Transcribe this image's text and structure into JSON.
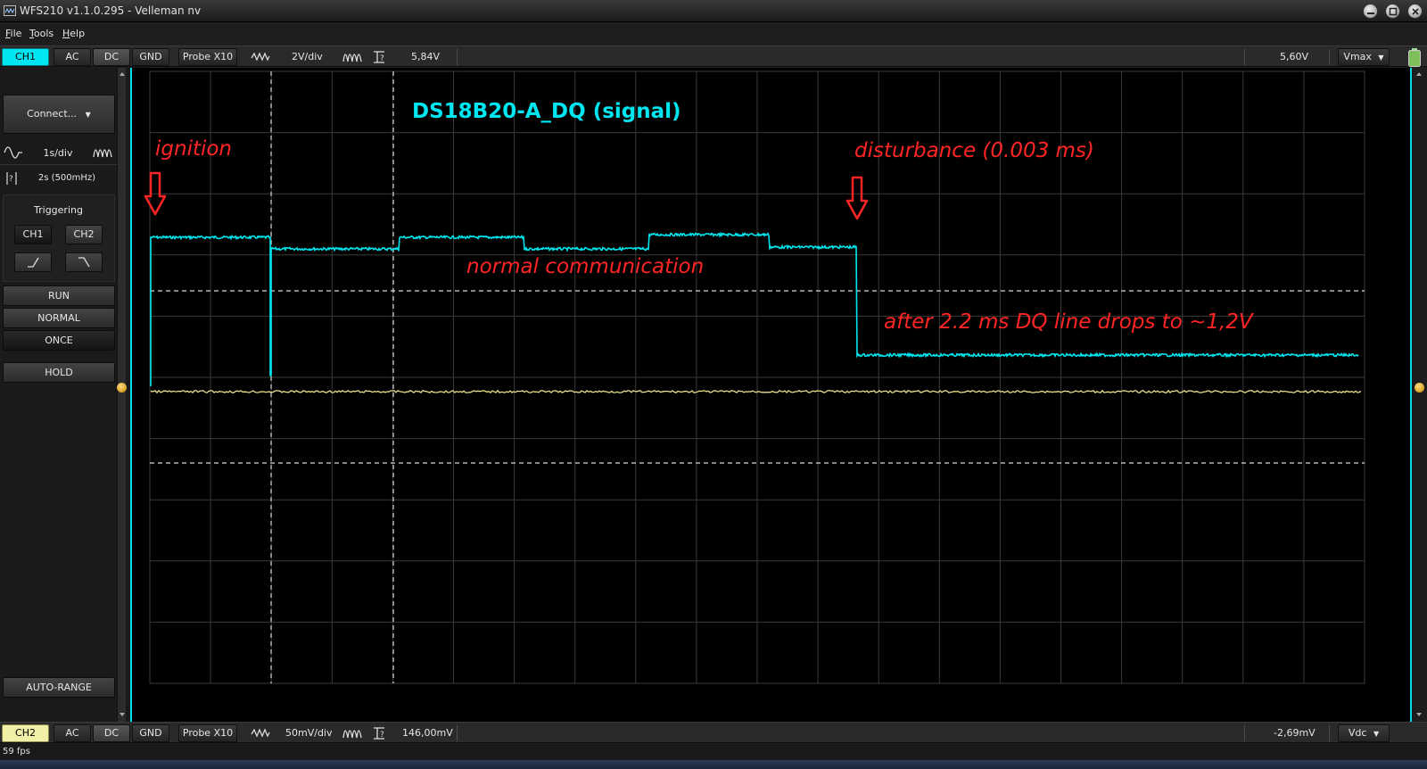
{
  "window": {
    "title": "WFS210 v1.1.0.295 - Velleman nv"
  },
  "menu": [
    "File",
    "Tools",
    "Help"
  ],
  "ch1_bar": {
    "channel": "CH1",
    "ac": "AC",
    "dc": "DC",
    "gnd": "GND",
    "probe": "Probe X10",
    "volt_div": "2V/div",
    "measure_value": "5,84V",
    "right_value": "5,60V",
    "mode": "Vmax"
  },
  "ch2_bar": {
    "channel": "CH2",
    "ac": "AC",
    "dc": "DC",
    "gnd": "GND",
    "probe": "Probe X10",
    "volt_div": "50mV/div",
    "measure_value": "146,00mV",
    "right_value": "-2,69mV",
    "mode": "Vdc"
  },
  "left_panel": {
    "connect": "Connect...",
    "time_div": "1s/div",
    "period": "2s (500mHz)",
    "triggering": "Triggering",
    "trig_ch1": "CH1",
    "trig_ch2": "CH2",
    "run": "RUN",
    "normal": "NORMAL",
    "once": "ONCE",
    "hold": "HOLD",
    "auto_range": "AUTO-RANGE"
  },
  "scope": {
    "title": "DS18B20-A_DQ (signal)",
    "annotations": {
      "ignition": "ignition",
      "disturbance": "disturbance (0.003 ms)",
      "normal": "normal communication",
      "drop": "after 2.2 ms DQ line drops to ~1,2V"
    },
    "colors": {
      "ch1_trace": "#00e6f0",
      "ch2_trace": "#e8e08a",
      "annotation": "#ff2525",
      "grid": "#3a3a3a"
    }
  },
  "status": {
    "fps": "59 fps"
  }
}
